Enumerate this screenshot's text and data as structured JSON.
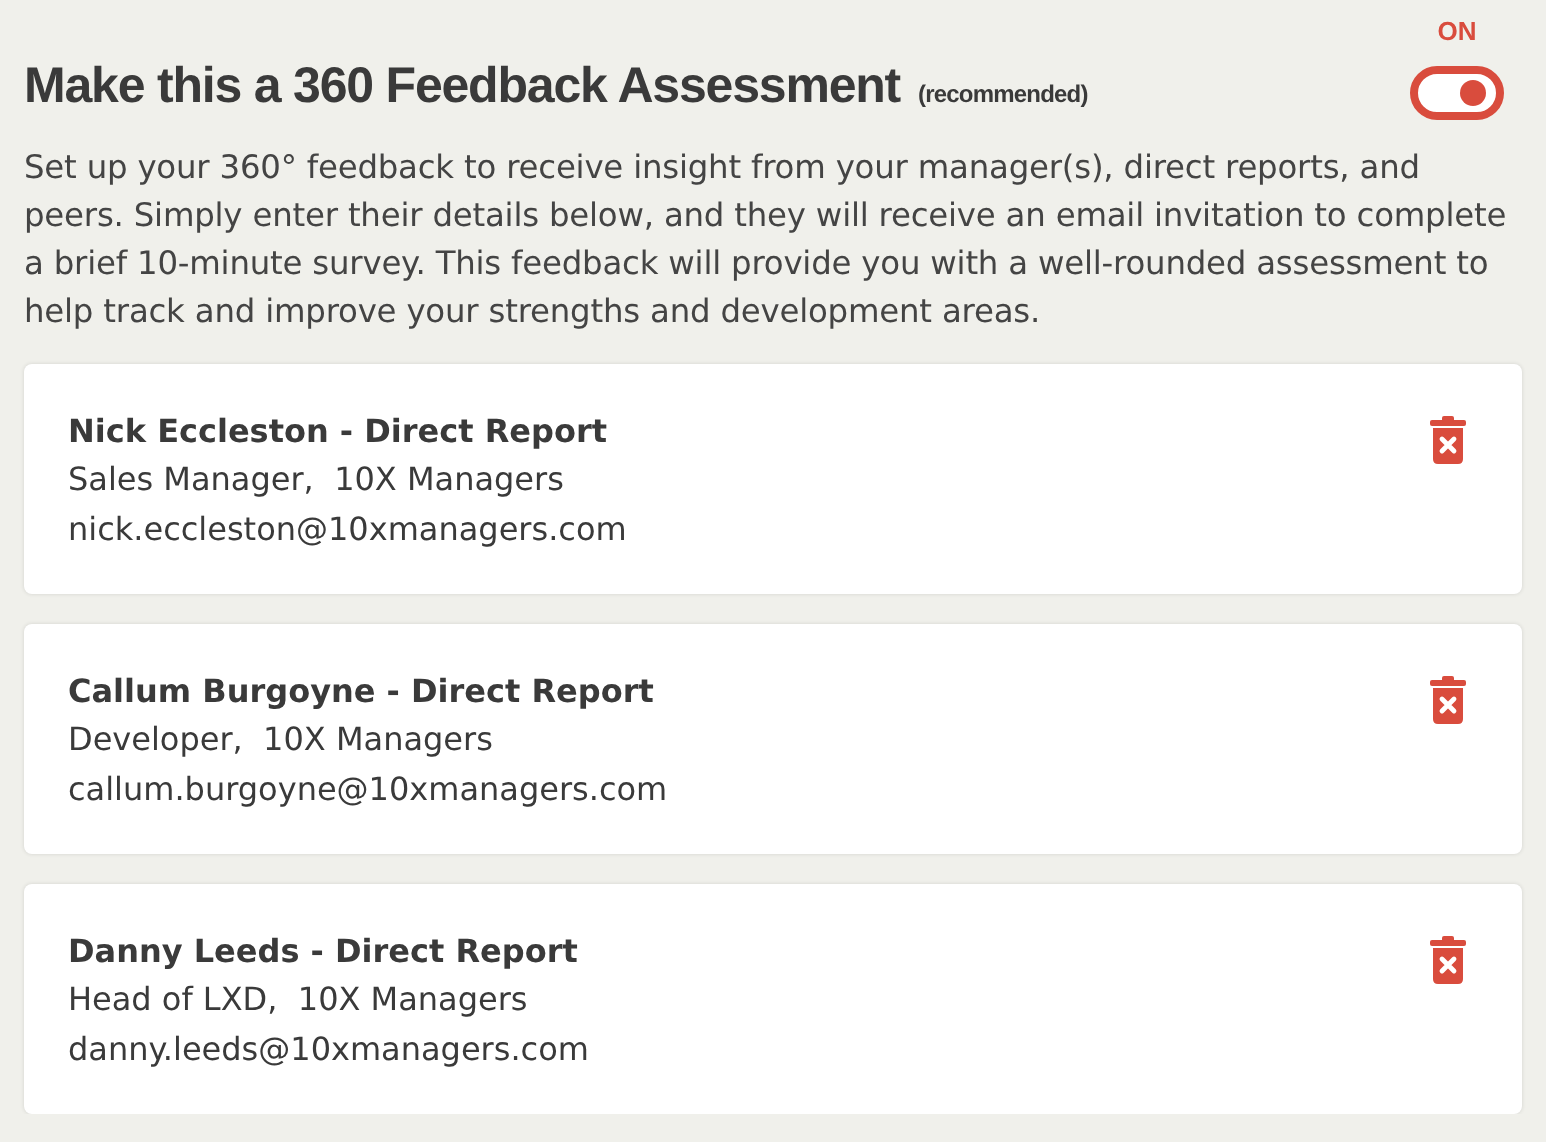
{
  "header": {
    "title": "Make this a 360 Feedback Assessment",
    "note": "(recommended)",
    "toggle": {
      "label": "ON",
      "on": true
    }
  },
  "description": "Set up your 360° feedback to receive insight from your manager(s), direct reports, and peers. Simply enter their details below, and they will receive an email invitation to complete a brief 10-minute survey. This feedback will provide you with a well-rounded assessment to help track and improve your strengths and development areas.",
  "reviewers": [
    {
      "name": "Nick Eccleston - Direct Report",
      "role": "Sales Manager,  10X Managers",
      "email": "nick.eccleston@10xmanagers.com"
    },
    {
      "name": "Callum Burgoyne - Direct Report",
      "role": "Developer,  10X Managers",
      "email": "callum.burgoyne@10xmanagers.com"
    },
    {
      "name": "Danny Leeds - Direct Report",
      "role": "Head of LXD,  10X Managers",
      "email": "danny.leeds@10xmanagers.com"
    }
  ]
}
